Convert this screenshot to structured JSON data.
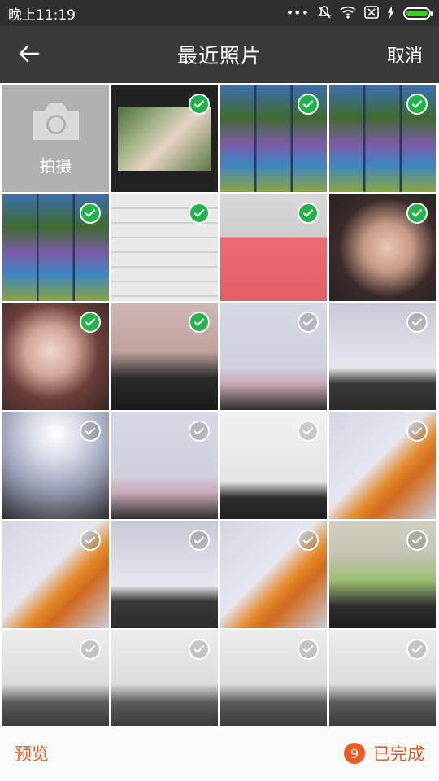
{
  "status_bar": {
    "time": "晚上11:19",
    "icons": [
      "more-dots-icon",
      "mute-icon",
      "wifi-icon",
      "sim-off-icon",
      "charging-icon",
      "battery-icon"
    ]
  },
  "header": {
    "back_icon": "arrow-left-icon",
    "title": "最近照片",
    "cancel_label": "取消"
  },
  "camera_tile": {
    "icon": "camera-icon",
    "label": "拍摄"
  },
  "photos": [
    {
      "scene": "park",
      "selected": true
    },
    {
      "scene": "wallpaper-grid",
      "selected": true
    },
    {
      "scene": "wallpaper-grid",
      "selected": true
    },
    {
      "scene": "wallpaper-grid",
      "selected": true
    },
    {
      "scene": "settings-form",
      "selected": true
    },
    {
      "scene": "red-dress",
      "selected": true
    },
    {
      "scene": "portrait",
      "selected": true
    },
    {
      "scene": "portrait",
      "selected": true
    },
    {
      "scene": "portrait",
      "selected": true
    },
    {
      "scene": "wall-tv",
      "selected": false
    },
    {
      "scene": "laptop",
      "selected": false
    },
    {
      "scene": "ceiling-light",
      "selected": false
    },
    {
      "scene": "wall-tv",
      "selected": false
    },
    {
      "scene": "code-screen",
      "selected": false
    },
    {
      "scene": "orange-bag",
      "selected": false
    },
    {
      "scene": "orange-bag",
      "selected": false
    },
    {
      "scene": "tablet",
      "selected": false
    },
    {
      "scene": "orange-bag",
      "selected": false
    },
    {
      "scene": "desk",
      "selected": false
    },
    {
      "scene": "keyboard",
      "selected": false
    },
    {
      "scene": "keyboard",
      "selected": false
    },
    {
      "scene": "keyboard",
      "selected": false
    },
    {
      "scene": "keyboard",
      "selected": false
    }
  ],
  "bottom_bar": {
    "preview_label": "预览",
    "selected_count": "9",
    "done_label": "已完成"
  },
  "colors": {
    "accent": "#f05a22",
    "check_green": "#1fb54a",
    "header_bg": "#3a3a3a"
  }
}
